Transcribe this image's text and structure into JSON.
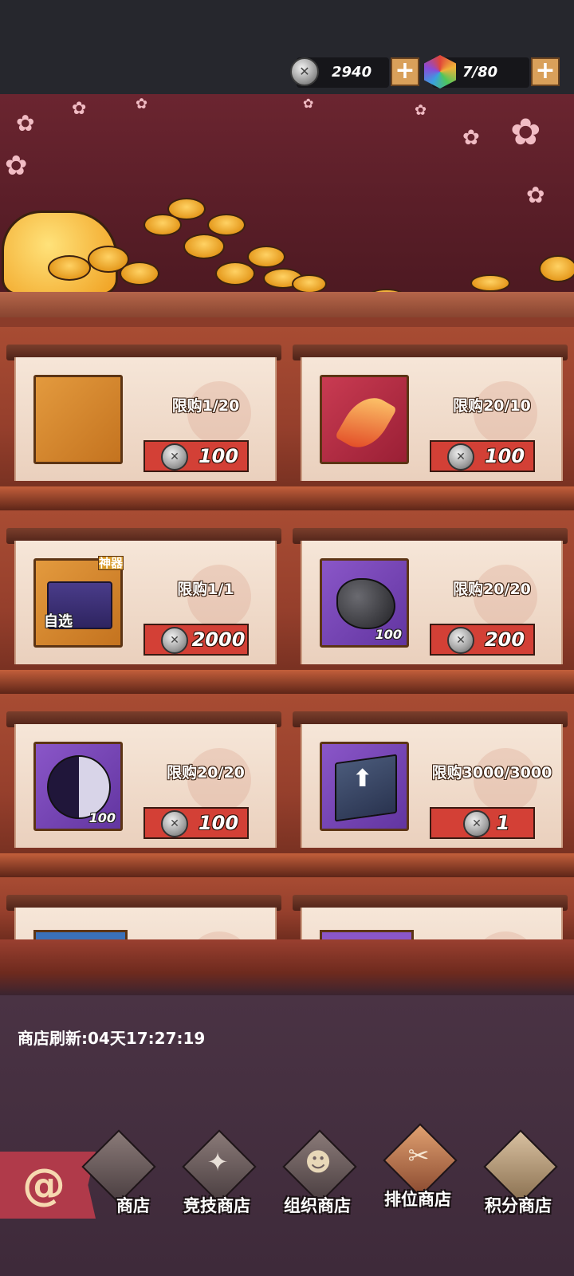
{
  "resources": {
    "coins": "2940",
    "energy": "7/80",
    "add_symbol": "+"
  },
  "shop": {
    "items": [
      {
        "limit": "限购1/20",
        "price": "100",
        "icon": "scroll-icon",
        "qty": "",
        "tag": "",
        "badge": ""
      },
      {
        "limit": "限购20/10",
        "price": "100",
        "icon": "feather-icon",
        "qty": "",
        "tag": "",
        "badge": ""
      },
      {
        "limit": "限购1/1",
        "price": "2000",
        "icon": "chest-icon",
        "qty": "",
        "tag": "自选",
        "badge": "神器"
      },
      {
        "limit": "限购20/20",
        "price": "200",
        "icon": "ore-icon",
        "qty": "100",
        "tag": "",
        "badge": ""
      },
      {
        "limit": "限购20/20",
        "price": "100",
        "icon": "yin-yang-icon",
        "qty": "100",
        "tag": "",
        "badge": ""
      },
      {
        "limit": "限购3000/3000",
        "price": "1",
        "icon": "book-icon",
        "qty": "",
        "tag": "",
        "badge": ""
      }
    ],
    "refresh": "商店刷新:04天17:27:19"
  },
  "tabs": [
    {
      "label": "商店",
      "icon": "shop-icon"
    },
    {
      "label": "竞技商店",
      "icon": "shuriken-icon"
    },
    {
      "label": "组织商店",
      "icon": "ninja-face-icon"
    },
    {
      "label": "排位商店",
      "icon": "kunai-icon"
    },
    {
      "label": "积分商店",
      "icon": "star-icon"
    }
  ],
  "colors": {
    "price_bar": "#d34036",
    "plus_button": "#d9a05a",
    "shelf": "#8b3c2a"
  }
}
